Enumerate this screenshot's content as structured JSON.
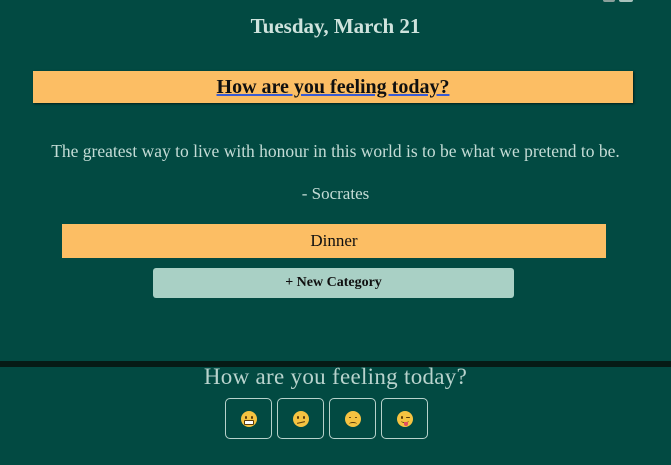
{
  "header": {
    "date": "Tuesday, March 21"
  },
  "prompt": {
    "question_link": "How are you feeling today?"
  },
  "quote": {
    "text": "The greatest way to live with honour in this world is to be what we pretend to be.",
    "author": "- Socrates"
  },
  "categories": [
    {
      "label": "Dinner"
    }
  ],
  "new_category_button": "+ New Category",
  "mood_section": {
    "question": "How are you feeling today?",
    "moods": [
      {
        "icon": "grinning-face-icon"
      },
      {
        "icon": "confused-face-icon"
      },
      {
        "icon": "pensive-face-icon"
      },
      {
        "icon": "winking-tongue-face-icon"
      }
    ]
  },
  "colors": {
    "background": "#024a42",
    "accent": "#fcbe64",
    "button": "#a9d0c5"
  }
}
